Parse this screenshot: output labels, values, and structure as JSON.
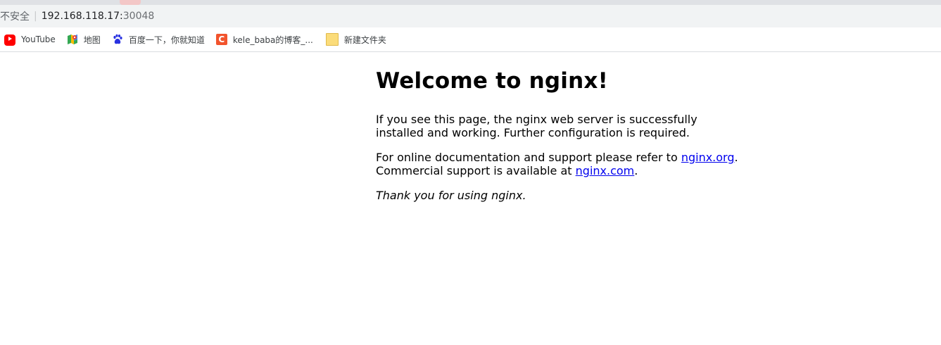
{
  "browser": {
    "security_label": "不安全",
    "separator": "|",
    "url_host": "192.168.118.17:",
    "url_port": "30048"
  },
  "bookmarks": [
    {
      "label": "YouTube",
      "icon": "youtube-icon"
    },
    {
      "label": "地图",
      "icon": "maps-icon"
    },
    {
      "label": "百度一下，你就知道",
      "icon": "baidu-paw-icon"
    },
    {
      "label": "kele_baba的博客_...",
      "icon": "csdn-icon"
    },
    {
      "label": "新建文件夹",
      "icon": "folder-icon"
    }
  ],
  "page": {
    "heading": "Welcome to nginx!",
    "para1": "If you see this page, the nginx web server is successfully installed and working. Further configuration is required.",
    "para2_prefix": "For online documentation and support please refer to ",
    "link_org": "nginx.org",
    "para2_mid": ".",
    "para2_line2": "Commercial support is available at ",
    "link_com": "nginx.com",
    "para2_end": ".",
    "thanks": "Thank you for using nginx."
  },
  "colors": {
    "link": "#0000ee",
    "youtube": "#ff0000",
    "csdn": "#f2542d",
    "folder": "#fbdc7a"
  }
}
